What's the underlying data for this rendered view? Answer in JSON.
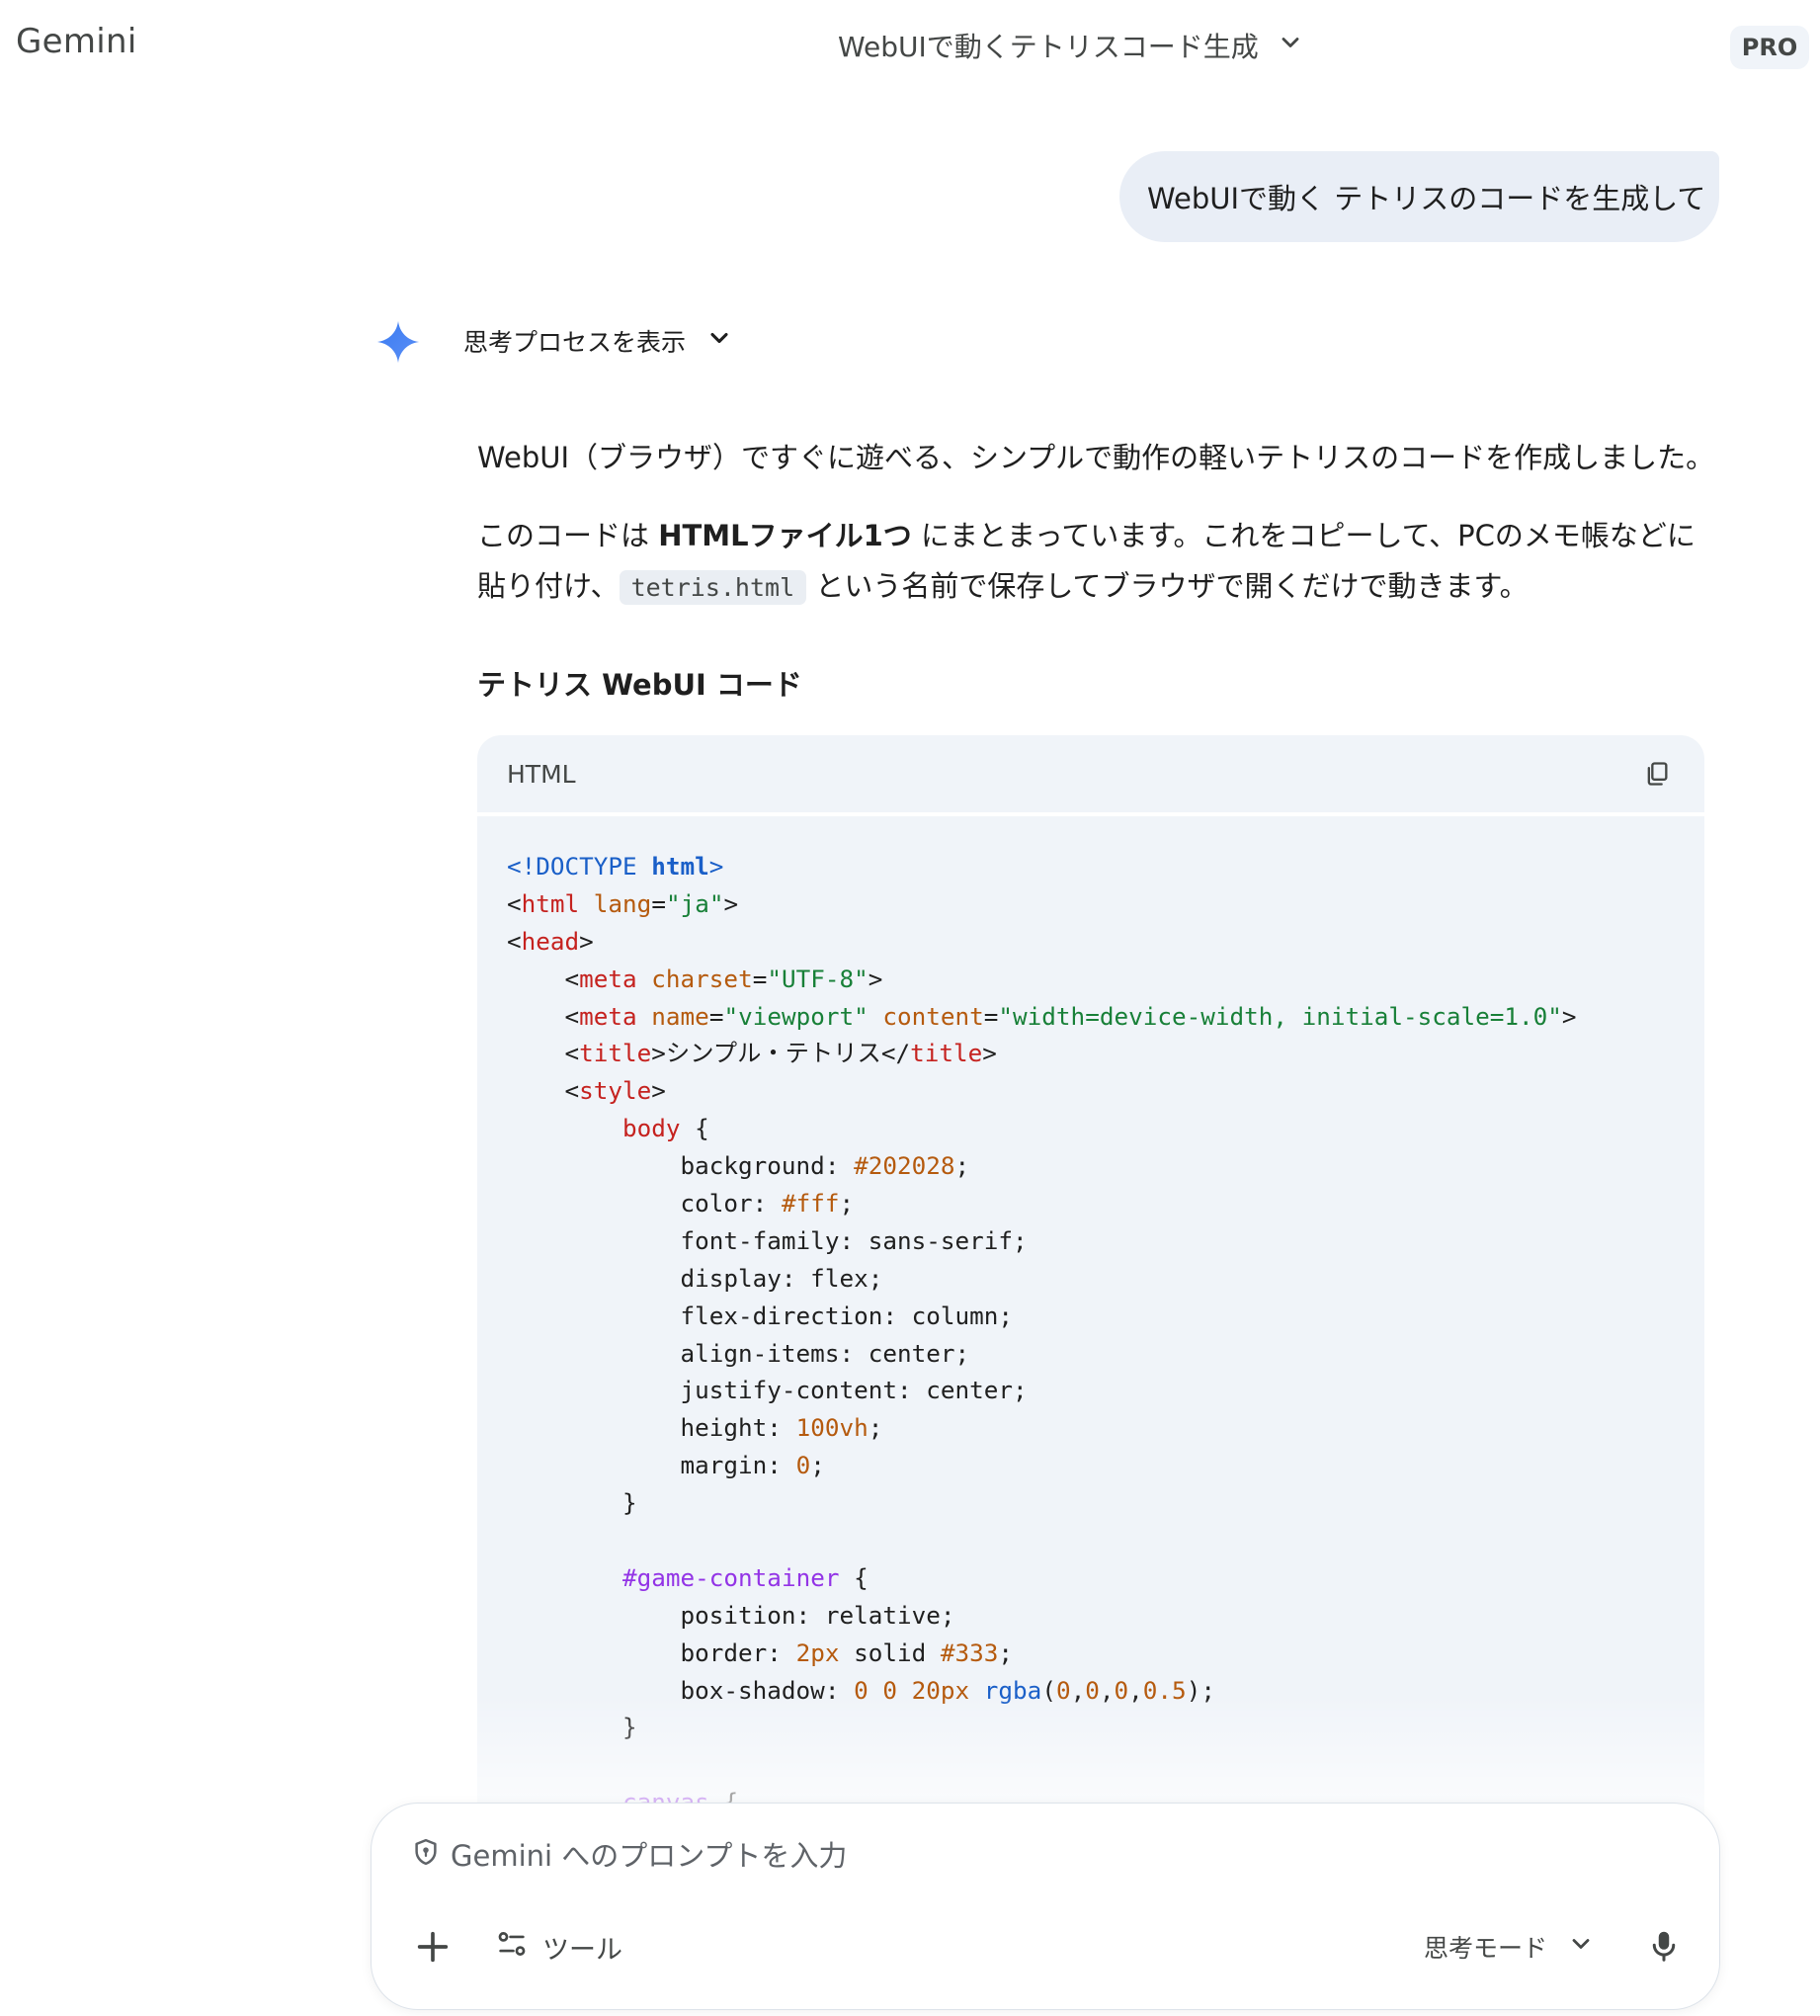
{
  "header": {
    "app_name": "Gemini",
    "conversation_title": "WebUIで動くテトリスコード生成",
    "plan_badge": "PRO"
  },
  "user_message": "WebUIで動く テトリスのコードを生成して",
  "response": {
    "thought_toggle_label": "思考プロセスを表示",
    "paragraph1": "WebUI（ブラウザ）ですぐに遊べる、シンプルで動作の軽いテトリスのコードを作成しました。",
    "paragraph2_part1": "このコードは ",
    "paragraph2_bold": "HTMLファイル1つ",
    "paragraph2_part2": " にまとまっています。これをコピーして、PCのメモ帳などに貼り付け、",
    "paragraph2_code": "tetris.html",
    "paragraph2_part3": " という名前で保存してブラウザで開くだけで動きます。",
    "section_heading": "テトリス WebUI コード",
    "code_block": {
      "language": "HTML",
      "lines": [
        [
          [
            "kw",
            "<!DOCTYPE "
          ],
          [
            "kwb",
            "html"
          ],
          [
            "kw",
            ">"
          ]
        ],
        [
          [
            "plain",
            "<"
          ],
          [
            "tag",
            "html"
          ],
          [
            "plain",
            " "
          ],
          [
            "attr",
            "lang"
          ],
          [
            "plain",
            "="
          ],
          [
            "str",
            "\"ja\""
          ],
          [
            "plain",
            ">"
          ]
        ],
        [
          [
            "plain",
            "<"
          ],
          [
            "tag",
            "head"
          ],
          [
            "plain",
            ">"
          ]
        ],
        [
          [
            "plain",
            "    <"
          ],
          [
            "tag",
            "meta"
          ],
          [
            "plain",
            " "
          ],
          [
            "attr",
            "charset"
          ],
          [
            "plain",
            "="
          ],
          [
            "str",
            "\"UTF-8\""
          ],
          [
            "plain",
            ">"
          ]
        ],
        [
          [
            "plain",
            "    <"
          ],
          [
            "tag",
            "meta"
          ],
          [
            "plain",
            " "
          ],
          [
            "attr",
            "name"
          ],
          [
            "plain",
            "="
          ],
          [
            "str",
            "\"viewport\""
          ],
          [
            "plain",
            " "
          ],
          [
            "attr",
            "content"
          ],
          [
            "plain",
            "="
          ],
          [
            "str",
            "\"width=device-width, initial-scale=1.0\""
          ],
          [
            "plain",
            ">"
          ]
        ],
        [
          [
            "plain",
            "    <"
          ],
          [
            "tag",
            "title"
          ],
          [
            "plain",
            ">シンプル・テトリス</"
          ],
          [
            "tag",
            "title"
          ],
          [
            "plain",
            ">"
          ]
        ],
        [
          [
            "plain",
            "    <"
          ],
          [
            "tag",
            "style"
          ],
          [
            "plain",
            ">"
          ]
        ],
        [
          [
            "plain",
            "        "
          ],
          [
            "sel",
            "body"
          ],
          [
            "plain",
            " {"
          ]
        ],
        [
          [
            "plain",
            "            background: "
          ],
          [
            "num",
            "#202028"
          ],
          [
            "plain",
            ";"
          ]
        ],
        [
          [
            "plain",
            "            color: "
          ],
          [
            "num",
            "#fff"
          ],
          [
            "plain",
            ";"
          ]
        ],
        [
          [
            "plain",
            "            font-family: sans-serif;"
          ]
        ],
        [
          [
            "plain",
            "            display: flex;"
          ]
        ],
        [
          [
            "plain",
            "            flex-direction: column;"
          ]
        ],
        [
          [
            "plain",
            "            align-items: center;"
          ]
        ],
        [
          [
            "plain",
            "            justify-content: center;"
          ]
        ],
        [
          [
            "plain",
            "            height: "
          ],
          [
            "num",
            "100vh"
          ],
          [
            "plain",
            ";"
          ]
        ],
        [
          [
            "plain",
            "            margin: "
          ],
          [
            "num",
            "0"
          ],
          [
            "plain",
            ";"
          ]
        ],
        [
          [
            "plain",
            "        }"
          ]
        ],
        [
          [
            "plain",
            ""
          ]
        ],
        [
          [
            "plain",
            "        "
          ],
          [
            "id",
            "#game-container"
          ],
          [
            "plain",
            " {"
          ]
        ],
        [
          [
            "plain",
            "            position: relative;"
          ]
        ],
        [
          [
            "plain",
            "            border: "
          ],
          [
            "num",
            "2px"
          ],
          [
            "plain",
            " solid "
          ],
          [
            "num",
            "#333"
          ],
          [
            "plain",
            ";"
          ]
        ],
        [
          [
            "plain",
            "            box-shadow: "
          ],
          [
            "num",
            "0"
          ],
          [
            "plain",
            " "
          ],
          [
            "num",
            "0"
          ],
          [
            "plain",
            " "
          ],
          [
            "num",
            "20px"
          ],
          [
            "plain",
            " "
          ],
          [
            "fn",
            "rgba"
          ],
          [
            "plain",
            "("
          ],
          [
            "num",
            "0"
          ],
          [
            "plain",
            ","
          ],
          [
            "num",
            "0"
          ],
          [
            "plain",
            ","
          ],
          [
            "num",
            "0"
          ],
          [
            "plain",
            ","
          ],
          [
            "num",
            "0.5"
          ],
          [
            "plain",
            ");"
          ]
        ],
        [
          [
            "plain",
            "        }"
          ]
        ],
        [
          [
            "plain",
            ""
          ]
        ],
        [
          [
            "plain",
            "        "
          ],
          [
            "id",
            "canvas"
          ],
          [
            "plain",
            " {"
          ]
        ]
      ]
    }
  },
  "input": {
    "placeholder": "Gemini へのプロンプトを入力",
    "tools_label": "ツール",
    "mode_label": "思考モード"
  },
  "icons": {
    "title_chevron": "chevron-down-icon",
    "spark": "gemini-spark-icon",
    "thought_chevron": "chevron-down-icon",
    "copy": "copy-icon",
    "shield": "shield-icon",
    "plus": "plus-icon",
    "tools": "tools-icon",
    "mode_chevron": "chevron-down-icon",
    "mic": "microphone-icon"
  },
  "colors": {
    "spark_blue": "#4285f4",
    "bubble_bg": "#e9eef6",
    "code_bg": "#f0f4f9"
  }
}
